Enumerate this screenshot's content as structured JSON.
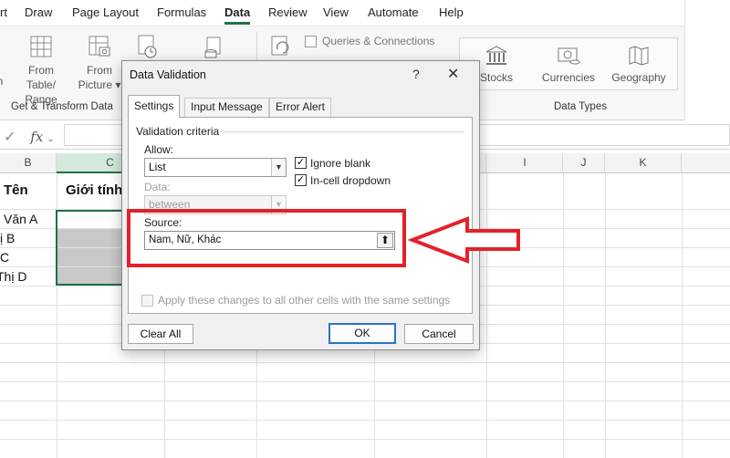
{
  "ribbon": {
    "tabs": [
      "rt",
      "Draw",
      "Page Layout",
      "Formulas",
      "Data",
      "Review",
      "View",
      "Automate",
      "Help"
    ],
    "active_tab": "Data",
    "from_table_label": [
      "From Table/",
      "Range"
    ],
    "from_picture_label": [
      "From",
      "Picture"
    ],
    "queries_connections": "Queries & Connections",
    "stocks": "Stocks",
    "currencies": "Currencies",
    "geography": "Geography",
    "group_get_transform": "Get & Transform Data",
    "group_data_types": "Data Types"
  },
  "formula_bar": {
    "fx": "fx"
  },
  "grid": {
    "columns": [
      "B",
      "C",
      "I",
      "J",
      "K"
    ],
    "header_row": [
      "Tên",
      "Giới tính"
    ],
    "names": [
      "Văn A",
      "ị B",
      "C",
      "Thị D"
    ]
  },
  "dialog": {
    "title": "Data Validation",
    "help": "?",
    "close": "✕",
    "tabs": [
      "Settings",
      "Input Message",
      "Error Alert"
    ],
    "active_tab": "Settings",
    "criteria_legend": "Validation criteria",
    "allow_label": "Allow:",
    "allow_value": "List",
    "data_label": "Data:",
    "data_value": "between",
    "ignore_blank": "Ignore blank",
    "in_cell_dropdown": "In-cell dropdown",
    "source_label": "Source:",
    "source_value": "Nam, Nữ, Khác",
    "apply_text": "Apply these changes to all other cells with the same settings",
    "clear_all": "Clear All",
    "ok": "OK",
    "cancel": "Cancel",
    "ignore_blank_checked": true,
    "in_cell_dropdown_checked": true,
    "apply_checked": false
  },
  "annotation_color": "#e3212a"
}
